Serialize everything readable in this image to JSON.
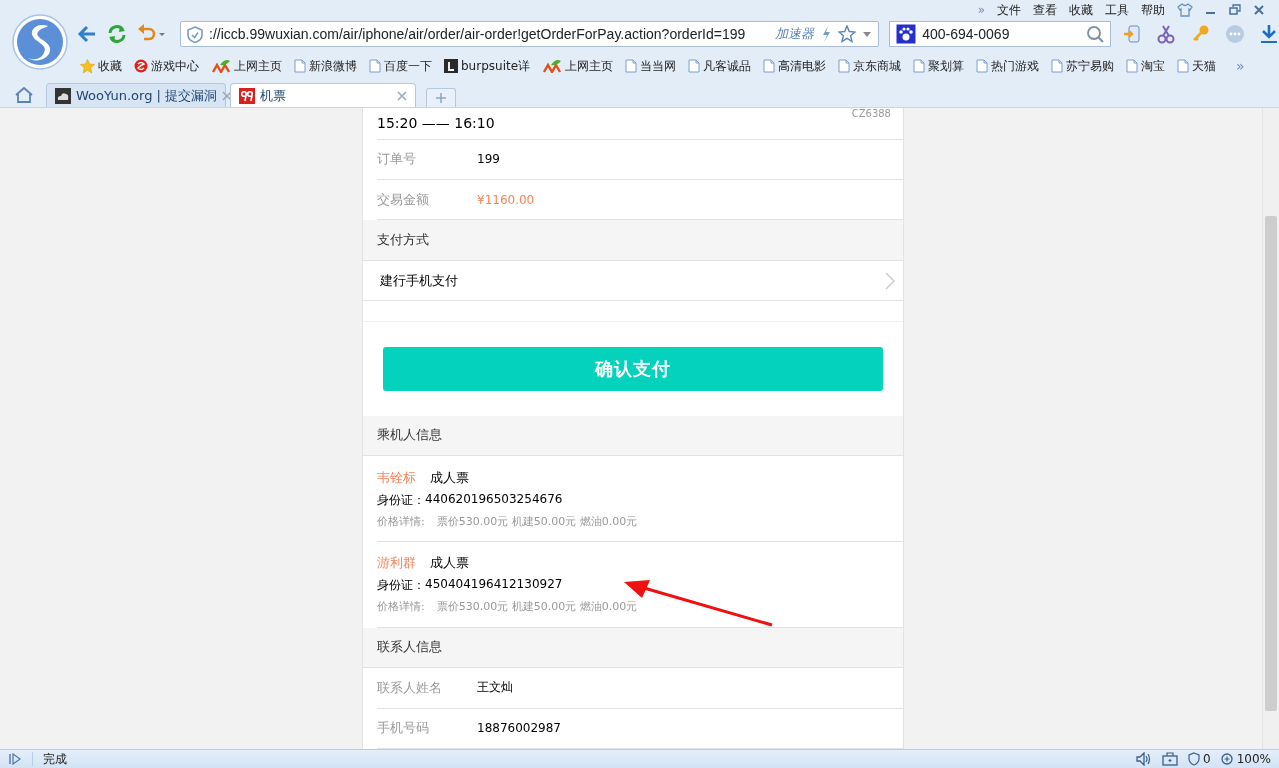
{
  "menu_bar": {
    "overflow": "»",
    "items": [
      "文件",
      "查看",
      "收藏",
      "工具",
      "帮助"
    ]
  },
  "address_bar": {
    "url": "://iccb.99wuxian.com/air/iphone/air/order/air-order!getOrderForPay.action?orderId=199",
    "accelerator": "加速器"
  },
  "search_box": {
    "value": "400-694-0069"
  },
  "bookmarks": [
    {
      "label": "收藏",
      "kind": "star"
    },
    {
      "label": "游戏中心",
      "kind": "game"
    },
    {
      "label": "上网主页",
      "kind": "hao"
    },
    {
      "label": "新浪微博",
      "kind": "page"
    },
    {
      "label": "百度一下",
      "kind": "page"
    },
    {
      "label": "burpsuite详",
      "kind": "letter"
    },
    {
      "label": "上网主页",
      "kind": "hao"
    },
    {
      "label": "当当网",
      "kind": "page"
    },
    {
      "label": "凡客诚品",
      "kind": "page"
    },
    {
      "label": "高清电影",
      "kind": "page"
    },
    {
      "label": "京东商城",
      "kind": "page"
    },
    {
      "label": "聚划算",
      "kind": "page"
    },
    {
      "label": "热门游戏",
      "kind": "page"
    },
    {
      "label": "苏宁易购",
      "kind": "page"
    },
    {
      "label": "淘宝",
      "kind": "page"
    },
    {
      "label": "天猫",
      "kind": "page"
    }
  ],
  "bookmarks_overflow": "»",
  "tabs": [
    {
      "label": "WooYun.org | 提交漏洞",
      "selected": false,
      "kind": "cloud"
    },
    {
      "label": "机票",
      "selected": true,
      "kind": "app"
    }
  ],
  "order": {
    "flight_code": "CZ6388",
    "time": "15:20 —— 16:10",
    "rows": [
      {
        "label": "订单号",
        "value": "199",
        "kind": "plain"
      },
      {
        "label": "交易金额",
        "value": "¥1160.00",
        "kind": "amount"
      }
    ],
    "payment_header": "支付方式",
    "payment_method": "建行手机支付",
    "confirm_button": "确认支付",
    "passenger_header": "乘机人信息",
    "passengers": [
      {
        "name": "韦铨标",
        "ticket_type": "成人票",
        "id_label": "身份证：",
        "id_number": "440620196503254676",
        "price_label": "价格详情:",
        "price_detail": "票价530.00元 机建50.00元 燃油0.00元"
      },
      {
        "name": "游利群",
        "ticket_type": "成人票",
        "id_label": "身份证：",
        "id_number": "450404196412130927",
        "price_label": "价格详情:",
        "price_detail": "票价530.00元 机建50.00元 燃油0.00元"
      }
    ],
    "contact_header": "联系人信息",
    "contact_rows": [
      {
        "label": "联系人姓名",
        "value": "王文灿"
      },
      {
        "label": "手机号码",
        "value": "18876002987"
      }
    ]
  },
  "status_bar": {
    "status": "完成",
    "blocked_count": "0",
    "zoom": "100%"
  }
}
